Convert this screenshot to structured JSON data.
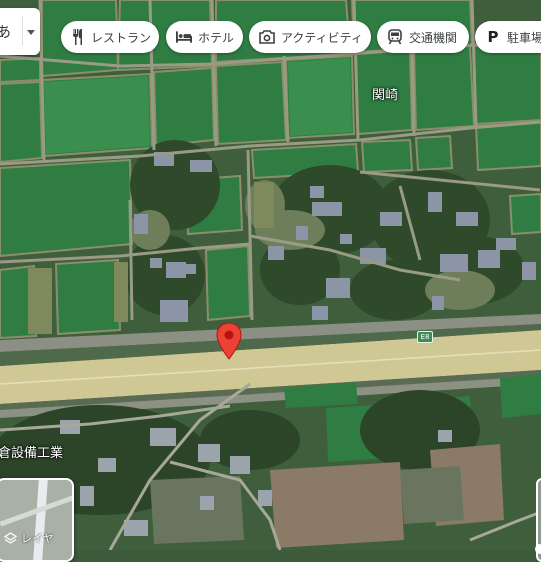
{
  "search": {
    "visible_text": "あ"
  },
  "chips": [
    {
      "label": "レストラン",
      "icon": "restaurant-icon"
    },
    {
      "label": "ホテル",
      "icon": "hotel-icon"
    },
    {
      "label": "アクティビティ",
      "icon": "camera-icon"
    },
    {
      "label": "交通機関",
      "icon": "transit-icon"
    },
    {
      "label": "駐車場",
      "icon": "parking-icon"
    }
  ],
  "map": {
    "place_label": "関崎",
    "business_label": "倉設備工業",
    "road_shield": "E8",
    "pin_color": "#ea4335"
  },
  "layer_button": {
    "label": "レイヤ",
    "icon": "layers-icon"
  }
}
